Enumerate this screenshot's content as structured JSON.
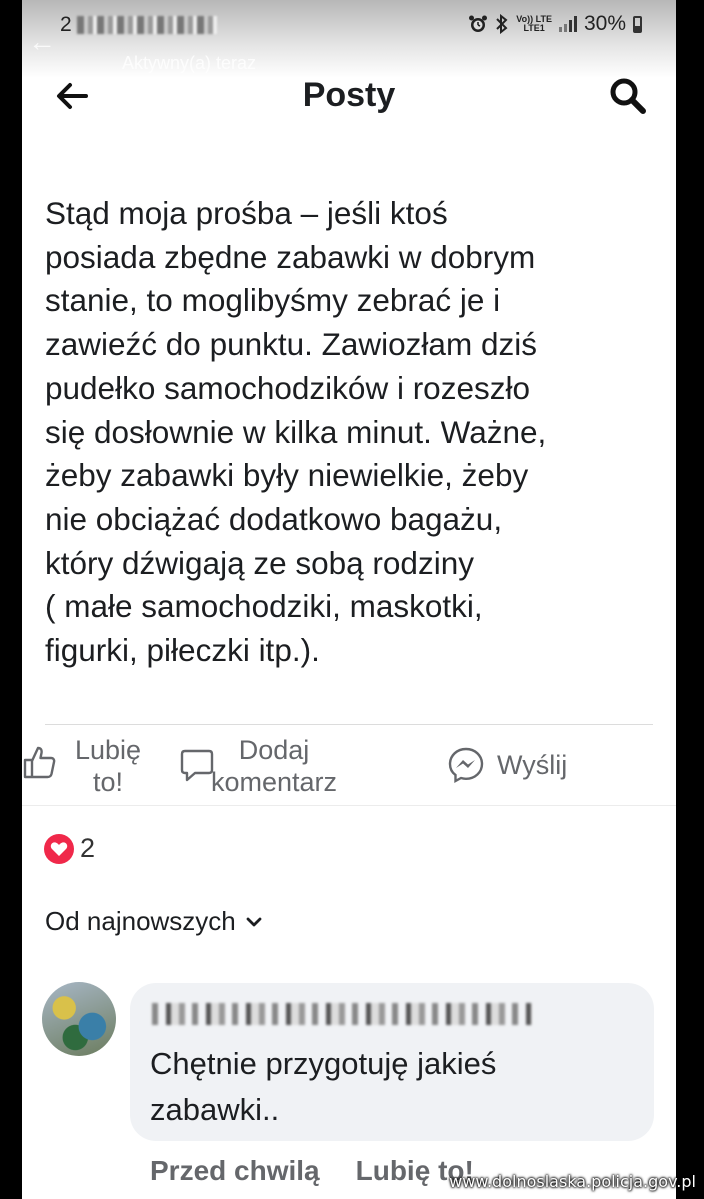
{
  "status_bar": {
    "time_partial": "2",
    "network_labels": [
      "Vo)) LTE",
      "LTE1"
    ],
    "battery": "30%"
  },
  "background_header": {
    "subtitle": "Aktywny(a) teraz"
  },
  "header": {
    "title": "Posty"
  },
  "post": {
    "lines": [
      "Stąd moja prośba – jeśli ktoś",
      "posiada zbędne zabawki w dobrym",
      "stanie, to moglibyśmy zebrać je i",
      "zawieźć do punktu. Zawiozłam dziś",
      "pudełko samochodzików i rozeszło",
      "się dosłownie w kilka minut. Ważne,",
      "żeby zabawki były niewielkie, żeby",
      "nie obciążać dodatkowo bagażu,",
      "który dźwigają ze sobą rodziny",
      "( małe samochodziki, maskotki,",
      "figurki, piłeczki itp.)."
    ]
  },
  "actions": {
    "like": [
      "Lubię",
      "to!"
    ],
    "comment": [
      "Dodaj",
      "komentarz"
    ],
    "send": "Wyślij"
  },
  "reactions": {
    "count": "2",
    "color": "#f0284a"
  },
  "sort": {
    "label": "Od najnowszych"
  },
  "comment": {
    "lines": [
      "Chętnie przygotuję jakieś",
      "zabawki.."
    ],
    "time": "Przed chwilą",
    "like": "Lubię to!"
  },
  "watermark": "www.dolnoslaska.policja.gov.pl"
}
